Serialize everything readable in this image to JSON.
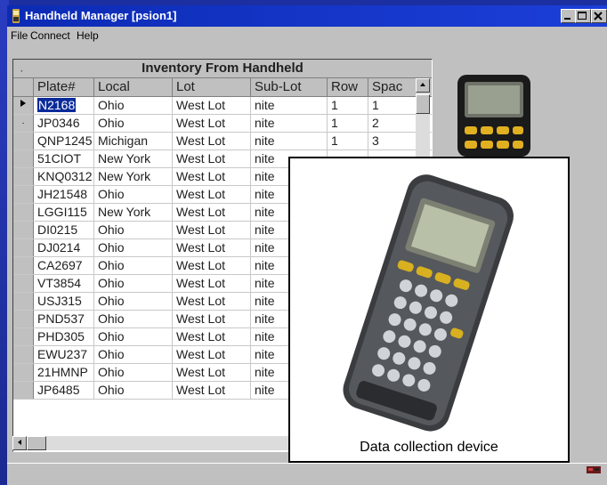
{
  "window": {
    "title": "Handheld Manager [psion1]",
    "controls": [
      "minimize",
      "maximize",
      "close"
    ]
  },
  "menu": {
    "items": [
      {
        "label": "File"
      },
      {
        "label": "Connect"
      },
      {
        "label": "Help"
      }
    ]
  },
  "grid": {
    "caption": "Inventory From Handheld",
    "columns": [
      "Plate#",
      "Local",
      "Lot",
      "Sub-Lot",
      "Row",
      "Spac"
    ],
    "rows": [
      [
        "N2168",
        "Ohio",
        "West Lot",
        "nite",
        "1",
        "1"
      ],
      [
        "JP0346",
        "Ohio",
        "West Lot",
        "nite",
        "1",
        "2"
      ],
      [
        "QNP1245",
        "Michigan",
        "West Lot",
        "nite",
        "1",
        "3"
      ],
      [
        "51CIOT",
        "New York",
        "West Lot",
        "nite",
        "",
        ""
      ],
      [
        "KNQ0312",
        "New York",
        "West Lot",
        "nite",
        "",
        ""
      ],
      [
        "JH21548",
        "Ohio",
        "West Lot",
        "nite",
        "",
        ""
      ],
      [
        "LGGI115",
        "New York",
        "West Lot",
        "nite",
        "",
        ""
      ],
      [
        "DI0215",
        "Ohio",
        "West Lot",
        "nite",
        "",
        ""
      ],
      [
        "DJ0214",
        "Ohio",
        "West Lot",
        "nite",
        "",
        ""
      ],
      [
        "CA2697",
        "Ohio",
        "West Lot",
        "nite",
        "",
        ""
      ],
      [
        "VT3854",
        "Ohio",
        "West Lot",
        "nite",
        "",
        ""
      ],
      [
        "USJ315",
        "Ohio",
        "West Lot",
        "nite",
        "",
        ""
      ],
      [
        "PND537",
        "Ohio",
        "West Lot",
        "nite",
        "",
        ""
      ],
      [
        "PHD305",
        "Ohio",
        "West Lot",
        "nite",
        "",
        ""
      ],
      [
        "EWU237",
        "Ohio",
        "West Lot",
        "nite",
        "",
        ""
      ],
      [
        "21HMNP",
        "Ohio",
        "West Lot",
        "nite",
        "",
        ""
      ],
      [
        "JP6485",
        "Ohio",
        "West Lot",
        "nite",
        "",
        ""
      ]
    ],
    "selected_row": 0
  },
  "device_card": {
    "caption": "Data collection device"
  },
  "colors": {
    "titlebar": "#0c2bb4",
    "selection": "#0a2a9a",
    "window": "#c0c0c0"
  }
}
